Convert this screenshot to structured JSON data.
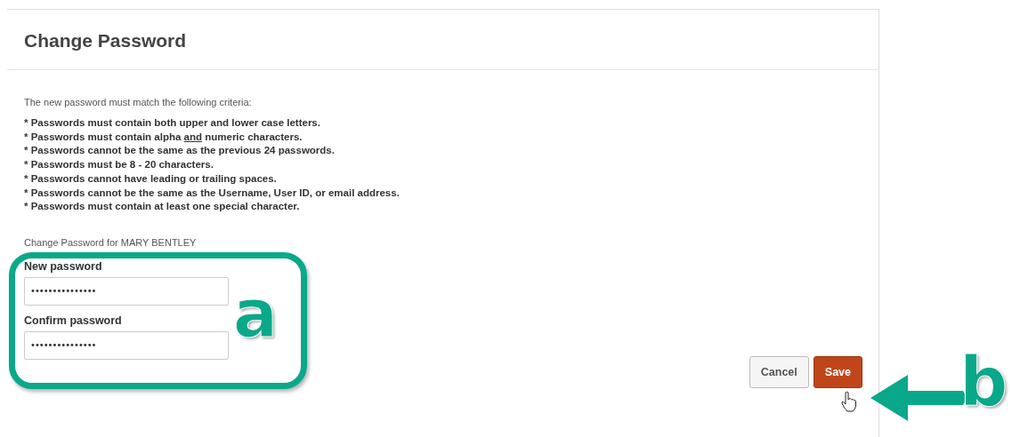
{
  "page": {
    "title": "Change Password"
  },
  "intro": "The new password must match the following criteria:",
  "criteria": [
    {
      "parts": [
        {
          "text": "* Passwords must contain both upper and lower case letters.",
          "underline": false
        }
      ]
    },
    {
      "parts": [
        {
          "text": "* Passwords must contain alpha ",
          "underline": false
        },
        {
          "text": "and",
          "underline": true
        },
        {
          "text": " numeric characters.",
          "underline": false
        }
      ]
    },
    {
      "parts": [
        {
          "text": "* Passwords cannot be the same as the previous 24 passwords.",
          "underline": false
        }
      ]
    },
    {
      "parts": [
        {
          "text": "* Passwords must be 8 - 20 characters.",
          "underline": false
        }
      ]
    },
    {
      "parts": [
        {
          "text": "* Passwords cannot have leading or trailing spaces.",
          "underline": false
        }
      ]
    },
    {
      "parts": [
        {
          "text": "* Passwords cannot be the same as the Username, User ID, or email address.",
          "underline": false
        }
      ]
    },
    {
      "parts": [
        {
          "text": "* Passwords must contain at least one special character.",
          "underline": false
        }
      ]
    }
  ],
  "for_user": "Change Password for MARY BENTLEY",
  "fields": [
    {
      "label": "New password",
      "value": "•••••••••••••••"
    },
    {
      "label": "Confirm password",
      "value": "•••••••••••••••"
    }
  ],
  "buttons": [
    {
      "label": "Cancel",
      "kind": "secondary"
    },
    {
      "label": "Save",
      "kind": "primary"
    }
  ],
  "callouts": [
    {
      "letter": "a",
      "kind": "box"
    },
    {
      "letter": "b",
      "kind": "arrow"
    }
  ]
}
